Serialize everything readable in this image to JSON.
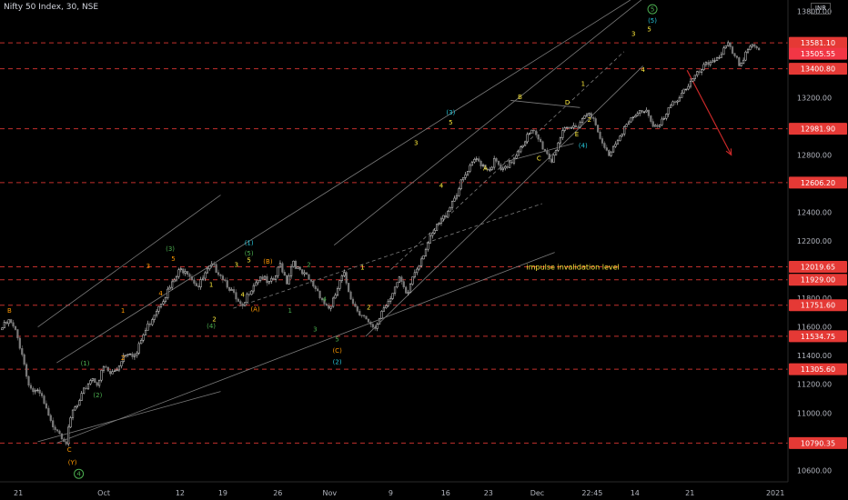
{
  "header": {
    "title": "Nifty 50 Index, 30, NSE"
  },
  "currency": "INR",
  "colors": {
    "background": "#000000",
    "candle_up": "#d9d9d9",
    "candle_down": "#7a7a7a",
    "level_line": "#e53935",
    "level_tag": "#e53935",
    "current_price_tag": "#f23645",
    "channel": "#7b7b7b",
    "wave_orange": "#ff9800",
    "wave_yellow": "#ffeb3b",
    "wave_green": "#4caf50",
    "wave_cyan": "#26c6da",
    "forecast_arrow": "#c62828",
    "annotation": "#ffeb3b"
  },
  "chart_data": {
    "type": "candlestick",
    "title": "Nifty 50 Index, 30, NSE",
    "x_tick_labels": [
      "21",
      "Oct",
      "12",
      "19",
      "26",
      "Nov",
      "9",
      "16",
      "23",
      "Dec",
      "22:45",
      "14",
      "21",
      "2021"
    ],
    "y_tick_labels": [
      10600,
      10800,
      11000,
      11200,
      11400,
      11600,
      11800,
      12000,
      12200,
      12400,
      12600,
      12800,
      13000,
      13200,
      13400,
      13600,
      13800
    ],
    "ylim": [
      10520,
      13880
    ],
    "levels": [
      13581.1,
      13400.8,
      12981.9,
      12606.2,
      12019.65,
      11929.0,
      11751.6,
      11534.75,
      11305.6,
      10790.35
    ],
    "current_price": 13505.55,
    "grid": false,
    "price_path": [
      [
        0,
        11580
      ],
      [
        0.5,
        11600
      ],
      [
        1.5,
        11640
      ],
      [
        2.5,
        11560
      ],
      [
        3.5,
        11420
      ],
      [
        4.2,
        11260
      ],
      [
        5,
        11160
      ],
      [
        6.5,
        11120
      ],
      [
        8,
        10930
      ],
      [
        9,
        10900
      ],
      [
        10.5,
        10800
      ],
      [
        11.5,
        11010
      ],
      [
        12.5,
        11060
      ],
      [
        13.5,
        11170
      ],
      [
        14.5,
        11250
      ],
      [
        15.5,
        11210
      ],
      [
        16.5,
        11320
      ],
      [
        17.5,
        11270
      ],
      [
        18.5,
        11300
      ],
      [
        19.5,
        11400
      ],
      [
        20.5,
        11440
      ],
      [
        21.5,
        11390
      ],
      [
        22.5,
        11520
      ],
      [
        23.5,
        11610
      ],
      [
        24.5,
        11700
      ],
      [
        25.5,
        11780
      ],
      [
        26.5,
        11840
      ],
      [
        27.5,
        11910
      ],
      [
        28.5,
        11990
      ],
      [
        29.5,
        12010
      ],
      [
        30.5,
        11940
      ],
      [
        31.5,
        11880
      ],
      [
        32.5,
        11960
      ],
      [
        33.5,
        12020
      ],
      [
        34.5,
        12000
      ],
      [
        35.5,
        11940
      ],
      [
        36.5,
        11870
      ],
      [
        37.5,
        11780
      ],
      [
        38.5,
        11720
      ],
      [
        39.5,
        11850
      ],
      [
        40.5,
        11920
      ],
      [
        41.5,
        11960
      ],
      [
        42.5,
        11890
      ],
      [
        43.5,
        11930
      ],
      [
        44.5,
        12040
      ],
      [
        45.5,
        11920
      ],
      [
        46.5,
        12070
      ],
      [
        47.5,
        11980
      ],
      [
        48.5,
        11950
      ],
      [
        49.5,
        11900
      ],
      [
        50.5,
        11850
      ],
      [
        51.5,
        11760
      ],
      [
        52.5,
        11730
      ],
      [
        53.5,
        11860
      ],
      [
        54.5,
        11970
      ],
      [
        55.5,
        11830
      ],
      [
        56.5,
        11730
      ],
      [
        57.5,
        11690
      ],
      [
        58.5,
        11610
      ],
      [
        59.5,
        11570
      ],
      [
        60.5,
        11710
      ],
      [
        61.5,
        11780
      ],
      [
        62.5,
        11870
      ],
      [
        63.5,
        11930
      ],
      [
        64.5,
        11800
      ],
      [
        65.5,
        11960
      ],
      [
        66.5,
        12050
      ],
      [
        67.5,
        12150
      ],
      [
        68.5,
        12230
      ],
      [
        69.5,
        12310
      ],
      [
        70.5,
        12370
      ],
      [
        71.5,
        12460
      ],
      [
        72.5,
        12540
      ],
      [
        73.5,
        12630
      ],
      [
        74.5,
        12700
      ],
      [
        75.5,
        12770
      ],
      [
        76.5,
        12740
      ],
      [
        77.5,
        12700
      ],
      [
        78.5,
        12760
      ],
      [
        79.5,
        12690
      ],
      [
        80.5,
        12700
      ],
      [
        81.5,
        12780
      ],
      [
        82.5,
        12860
      ],
      [
        83.5,
        12920
      ],
      [
        84.5,
        12960
      ],
      [
        85.5,
        12900
      ],
      [
        86.5,
        12830
      ],
      [
        87.5,
        12760
      ],
      [
        88.5,
        12890
      ],
      [
        89.5,
        12960
      ],
      [
        90.5,
        12980
      ],
      [
        91.5,
        13010
      ],
      [
        92.5,
        13060
      ],
      [
        93.5,
        13120
      ],
      [
        94.5,
        12990
      ],
      [
        95.5,
        12870
      ],
      [
        96.5,
        12800
      ],
      [
        97.5,
        12880
      ],
      [
        98.5,
        12960
      ],
      [
        99.5,
        13010
      ],
      [
        100.5,
        13050
      ],
      [
        101.5,
        13100
      ],
      [
        102.5,
        13120
      ],
      [
        103.5,
        13020
      ],
      [
        104.5,
        12990
      ],
      [
        105.5,
        13060
      ],
      [
        106.5,
        13140
      ],
      [
        107.5,
        13200
      ],
      [
        108.5,
        13260
      ],
      [
        109.5,
        13300
      ],
      [
        110.5,
        13350
      ],
      [
        111.5,
        13400
      ],
      [
        112.5,
        13440
      ],
      [
        113.5,
        13480
      ],
      [
        114.5,
        13510
      ],
      [
        115.5,
        13560
      ],
      [
        116.5,
        13470
      ],
      [
        117.5,
        13430
      ],
      [
        118.5,
        13540
      ],
      [
        119.5,
        13580
      ],
      [
        120.5,
        13500
      ]
    ],
    "wave_labels": [
      {
        "text": "B",
        "x": 1.5,
        "y": 11700,
        "color": "orange"
      },
      {
        "text": "C",
        "x": 11,
        "y": 10730,
        "color": "orange"
      },
      {
        "text": "(Y)",
        "x": 11.5,
        "y": 10640,
        "color": "orange"
      },
      {
        "text": "4",
        "x": 12.5,
        "y": 10560,
        "color": "green",
        "circled": true
      },
      {
        "text": "(1)",
        "x": 13.5,
        "y": 11330,
        "color": "green"
      },
      {
        "text": "(2)",
        "x": 15.5,
        "y": 11110,
        "color": "green"
      },
      {
        "text": "1",
        "x": 19.5,
        "y": 11700,
        "color": "orange"
      },
      {
        "text": "2",
        "x": 19.5,
        "y": 11370,
        "color": "orange"
      },
      {
        "text": "3",
        "x": 23.5,
        "y": 12010,
        "color": "orange"
      },
      {
        "text": "4",
        "x": 25.5,
        "y": 11820,
        "color": "orange"
      },
      {
        "text": "(3)",
        "x": 27,
        "y": 12130,
        "color": "green"
      },
      {
        "text": "5",
        "x": 27.5,
        "y": 12060,
        "color": "orange"
      },
      {
        "text": "1",
        "x": 33.5,
        "y": 11880,
        "color": "yellow"
      },
      {
        "text": "2",
        "x": 34,
        "y": 11640,
        "color": "yellow"
      },
      {
        "text": "3",
        "x": 37.5,
        "y": 12020,
        "color": "yellow"
      },
      {
        "text": "4",
        "x": 38.5,
        "y": 11810,
        "color": "yellow"
      },
      {
        "text": "(4)",
        "x": 33.5,
        "y": 11590,
        "color": "green"
      },
      {
        "text": "(1)",
        "x": 39.5,
        "y": 12170,
        "color": "cyan"
      },
      {
        "text": "(5)",
        "x": 39.5,
        "y": 12100,
        "color": "green"
      },
      {
        "text": "5",
        "x": 39.5,
        "y": 12050,
        "color": "yellow"
      },
      {
        "text": "(B)",
        "x": 42.5,
        "y": 12040,
        "color": "orange"
      },
      {
        "text": "(A)",
        "x": 40.5,
        "y": 11710,
        "color": "orange"
      },
      {
        "text": "2",
        "x": 49,
        "y": 12020,
        "color": "green"
      },
      {
        "text": "1",
        "x": 46,
        "y": 11700,
        "color": "green"
      },
      {
        "text": "4",
        "x": 51.5,
        "y": 11780,
        "color": "green"
      },
      {
        "text": "3",
        "x": 50,
        "y": 11570,
        "color": "green"
      },
      {
        "text": "5",
        "x": 53.5,
        "y": 11500,
        "color": "green"
      },
      {
        "text": "(C)",
        "x": 53.5,
        "y": 11420,
        "color": "orange"
      },
      {
        "text": "(2)",
        "x": 53.5,
        "y": 11340,
        "color": "cyan"
      },
      {
        "text": "1",
        "x": 57.5,
        "y": 12000,
        "color": "yellow"
      },
      {
        "text": "2",
        "x": 58.5,
        "y": 11720,
        "color": "yellow"
      },
      {
        "text": "3",
        "x": 66,
        "y": 12870,
        "color": "yellow"
      },
      {
        "text": "4",
        "x": 70,
        "y": 12570,
        "color": "yellow"
      },
      {
        "text": "(3)",
        "x": 71.5,
        "y": 13080,
        "color": "cyan"
      },
      {
        "text": "5",
        "x": 71.5,
        "y": 13010,
        "color": "yellow"
      },
      {
        "text": "A",
        "x": 77,
        "y": 12690,
        "color": "yellow"
      },
      {
        "text": "B",
        "x": 82.5,
        "y": 13190,
        "color": "yellow"
      },
      {
        "text": "C",
        "x": 85.5,
        "y": 12760,
        "color": "yellow"
      },
      {
        "text": "D",
        "x": 90,
        "y": 13150,
        "color": "yellow"
      },
      {
        "text": "E",
        "x": 91.5,
        "y": 12930,
        "color": "yellow"
      },
      {
        "text": "(4)",
        "x": 92.5,
        "y": 12850,
        "color": "cyan"
      },
      {
        "text": "1",
        "x": 92.5,
        "y": 13280,
        "color": "yellow"
      },
      {
        "text": "2",
        "x": 93.5,
        "y": 13030,
        "color": "yellow"
      },
      {
        "text": "3",
        "x": 100.5,
        "y": 13630,
        "color": "yellow"
      },
      {
        "text": "4",
        "x": 102,
        "y": 13380,
        "color": "yellow"
      },
      {
        "text": "5",
        "x": 103,
        "y": 13660,
        "color": "yellow"
      },
      {
        "text": "(5)",
        "x": 103.5,
        "y": 13720,
        "color": "cyan"
      },
      {
        "text": "5",
        "x": 103.5,
        "y": 13800,
        "color": "green",
        "circled": true
      }
    ],
    "annotations": [
      {
        "text": "impulse invalidation level",
        "x": 83.5,
        "y": 12000
      }
    ],
    "trend_lines": [
      {
        "x1": 6,
        "y1": 11600,
        "x2": 35,
        "y2": 12520
      },
      {
        "x1": 6,
        "y1": 10800,
        "x2": 35,
        "y2": 11150
      },
      {
        "x1": 9,
        "y1": 10790,
        "x2": 88,
        "y2": 12120
      },
      {
        "x1": 9,
        "y1": 11350,
        "x2": 100,
        "y2": 13880
      },
      {
        "x1": 58,
        "y1": 11534,
        "x2": 102,
        "y2": 13420
      },
      {
        "x1": 53,
        "y1": 12170,
        "x2": 104,
        "y2": 13960
      },
      {
        "x1": 80,
        "y1": 12750,
        "x2": 91,
        "y2": 12880
      },
      {
        "x1": 81,
        "y1": 13180,
        "x2": 92,
        "y2": 13130
      }
    ],
    "dashed_trend_lines": [
      {
        "x1": 37,
        "y1": 11730,
        "x2": 86,
        "y2": 12460
      },
      {
        "x1": 62,
        "y1": 12000,
        "x2": 99,
        "y2": 13520
      }
    ],
    "forecast_arrow": {
      "x1": 109,
      "y1": 13390,
      "x2": 116,
      "y2": 12800
    }
  }
}
